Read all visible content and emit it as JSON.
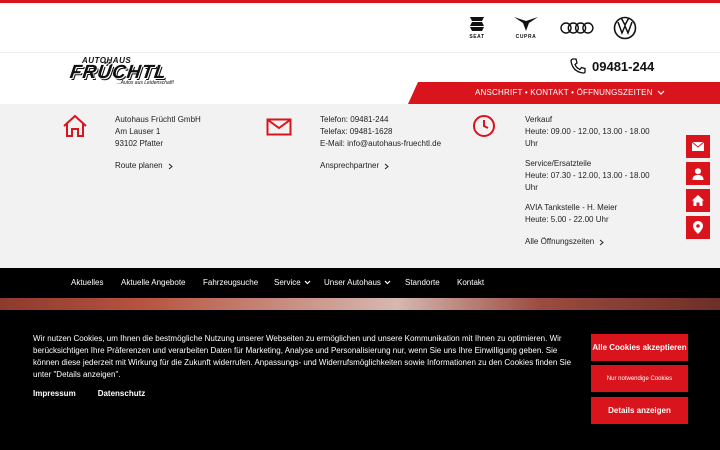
{
  "brands": [
    {
      "name": "SEAT",
      "label": "SEAT"
    },
    {
      "name": "CUPRA",
      "label": "CUPRA"
    },
    {
      "name": "Audi",
      "label": ""
    },
    {
      "name": "Volkswagen",
      "label": ""
    }
  ],
  "logo": {
    "top": "AUTOHAUS",
    "main": "FRÜCHTL",
    "sub": "...Autos aus Leidenschaft!"
  },
  "header": {
    "phone": "09481-244",
    "redbar_links": "ANSCHRIFT • KONTAKT • ÖFFNUNGSZEITEN"
  },
  "address": {
    "company": "Autohaus Früchtl GmbH",
    "street": "Am Lauser 1",
    "city": "93102 Pfatter",
    "link": "Route planen"
  },
  "contact": {
    "phone": "Telefon: 09481-244",
    "fax": "Telefax: 09481-1628",
    "email": "E-Mail: info@autohaus-fruechtl.de",
    "link": "Ansprechpartner"
  },
  "hours": {
    "sales_title": "Verkauf",
    "sales_hours": "Heute: 09.00 - 12.00, 13.00 - 18.00",
    "sales_suffix": "Uhr",
    "service_title": "Service/Ersatzteile",
    "service_hours": "Heute: 07.30 - 12.00, 13.00 - 18.00",
    "service_suffix": "Uhr",
    "station_title": "AVIA Tankstelle - H. Meier",
    "station_hours": "Heute: 5.00 - 22.00 Uhr",
    "link": "Alle Öffnungszeiten"
  },
  "nav": {
    "items": [
      "Aktuelles",
      "Aktuelle Angebote",
      "Fahrzeugsuche",
      "Service",
      "Unser Autohaus",
      "Standorte",
      "Kontakt"
    ]
  },
  "cookie": {
    "text": "Wir nutzen Cookies, um Ihnen die bestmögliche Nutzung unserer Webseiten zu ermöglichen und unsere Kommunikation mit Ihnen zu optimieren. Wir berücksichtigen Ihre Präferenzen und verarbeiten Daten für Marketing, Analyse und Personalisierung nur, wenn Sie uns Ihre Einwilligung geben. Sie können diese jederzeit mit Wirkung für die Zukunft widerrufen. Anpassungs- und Widerrufsmöglichkeiten sowie Informationen zu den Cookies finden Sie unter \"Details anzeigen\".",
    "impressum": "Impressum",
    "datenschutz": "Datenschutz",
    "accept_all": "Alle Cookies akzeptieren",
    "necessary_only": "Nur notwendige Cookies",
    "details": "Details anzeigen"
  },
  "icons": {
    "home": "home-icon",
    "mail": "mail-icon",
    "clock": "clock-icon",
    "phone": "phone-icon",
    "side_buttons": [
      "mail-icon",
      "person-icon",
      "home-icon",
      "location-pin-icon"
    ]
  },
  "colors": {
    "accent": "#d9141c",
    "nav_bg": "#000000",
    "info_bg": "#f2f2f2"
  }
}
